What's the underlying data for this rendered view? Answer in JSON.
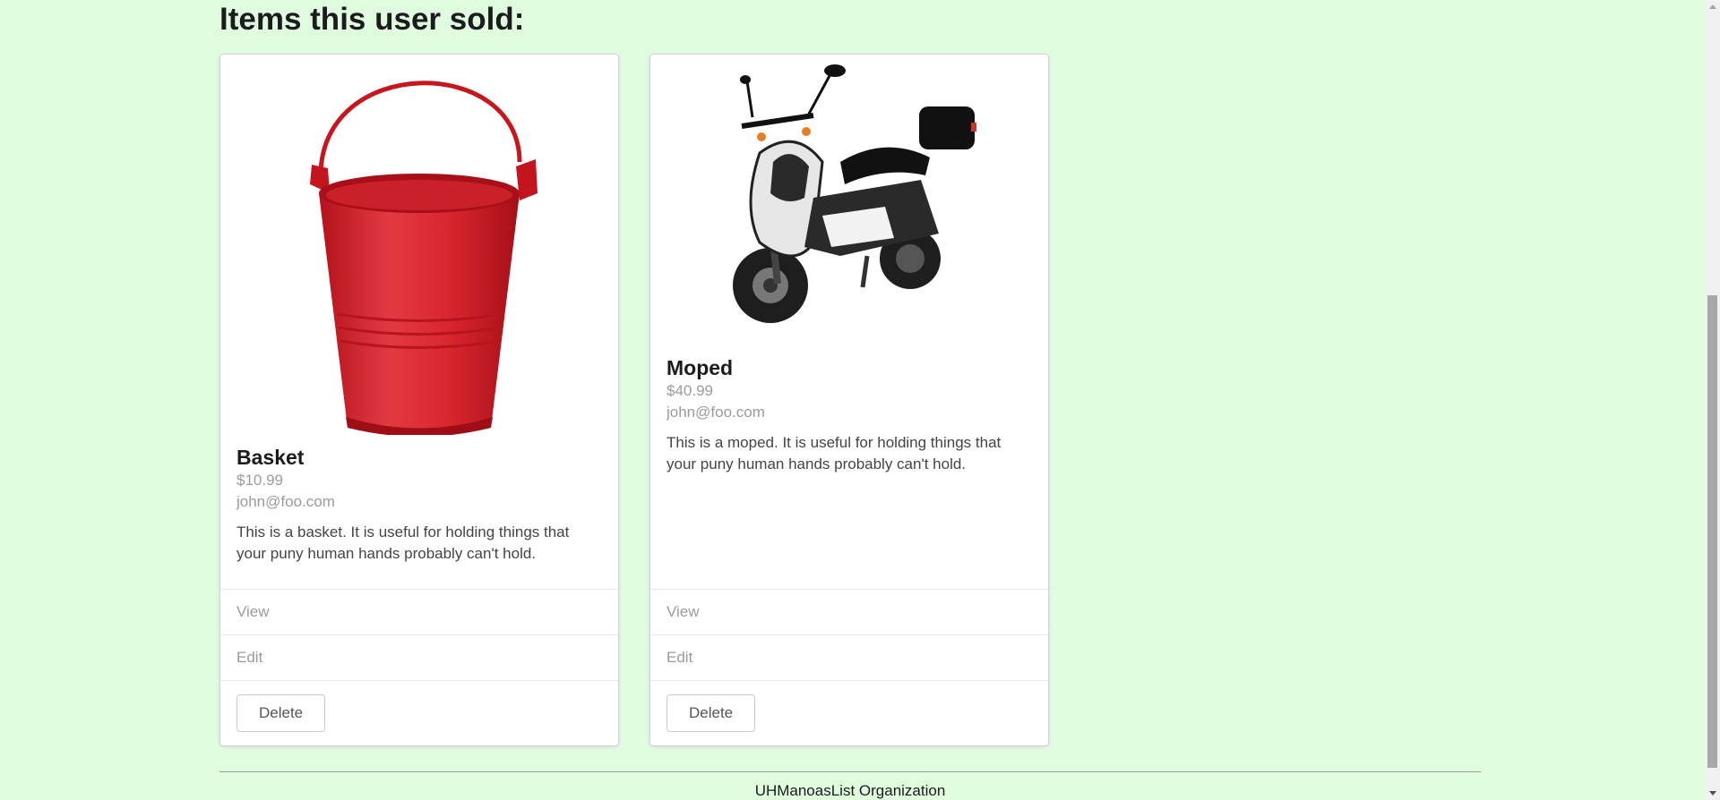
{
  "page": {
    "heading": "Items this user sold:"
  },
  "items": [
    {
      "image_icon": "red-bucket-image",
      "title": "Basket",
      "price": "$10.99",
      "owner": "john@foo.com",
      "description": "This is a basket. It is useful for holding things that your puny human hands probably can't hold.",
      "view_label": "View",
      "edit_label": "Edit",
      "delete_label": "Delete"
    },
    {
      "image_icon": "moped-image",
      "title": "Moped",
      "price": "$40.99",
      "owner": "john@foo.com",
      "description": "This is a moped. It is useful for holding things that your puny human hands probably can't hold.",
      "view_label": "View",
      "edit_label": "Edit",
      "delete_label": "Delete"
    }
  ],
  "footer": {
    "text": "UHManoasList Organization"
  },
  "colors": {
    "background": "#dffcdf",
    "card": "#ffffff",
    "bucket_red": "#d9262f"
  }
}
